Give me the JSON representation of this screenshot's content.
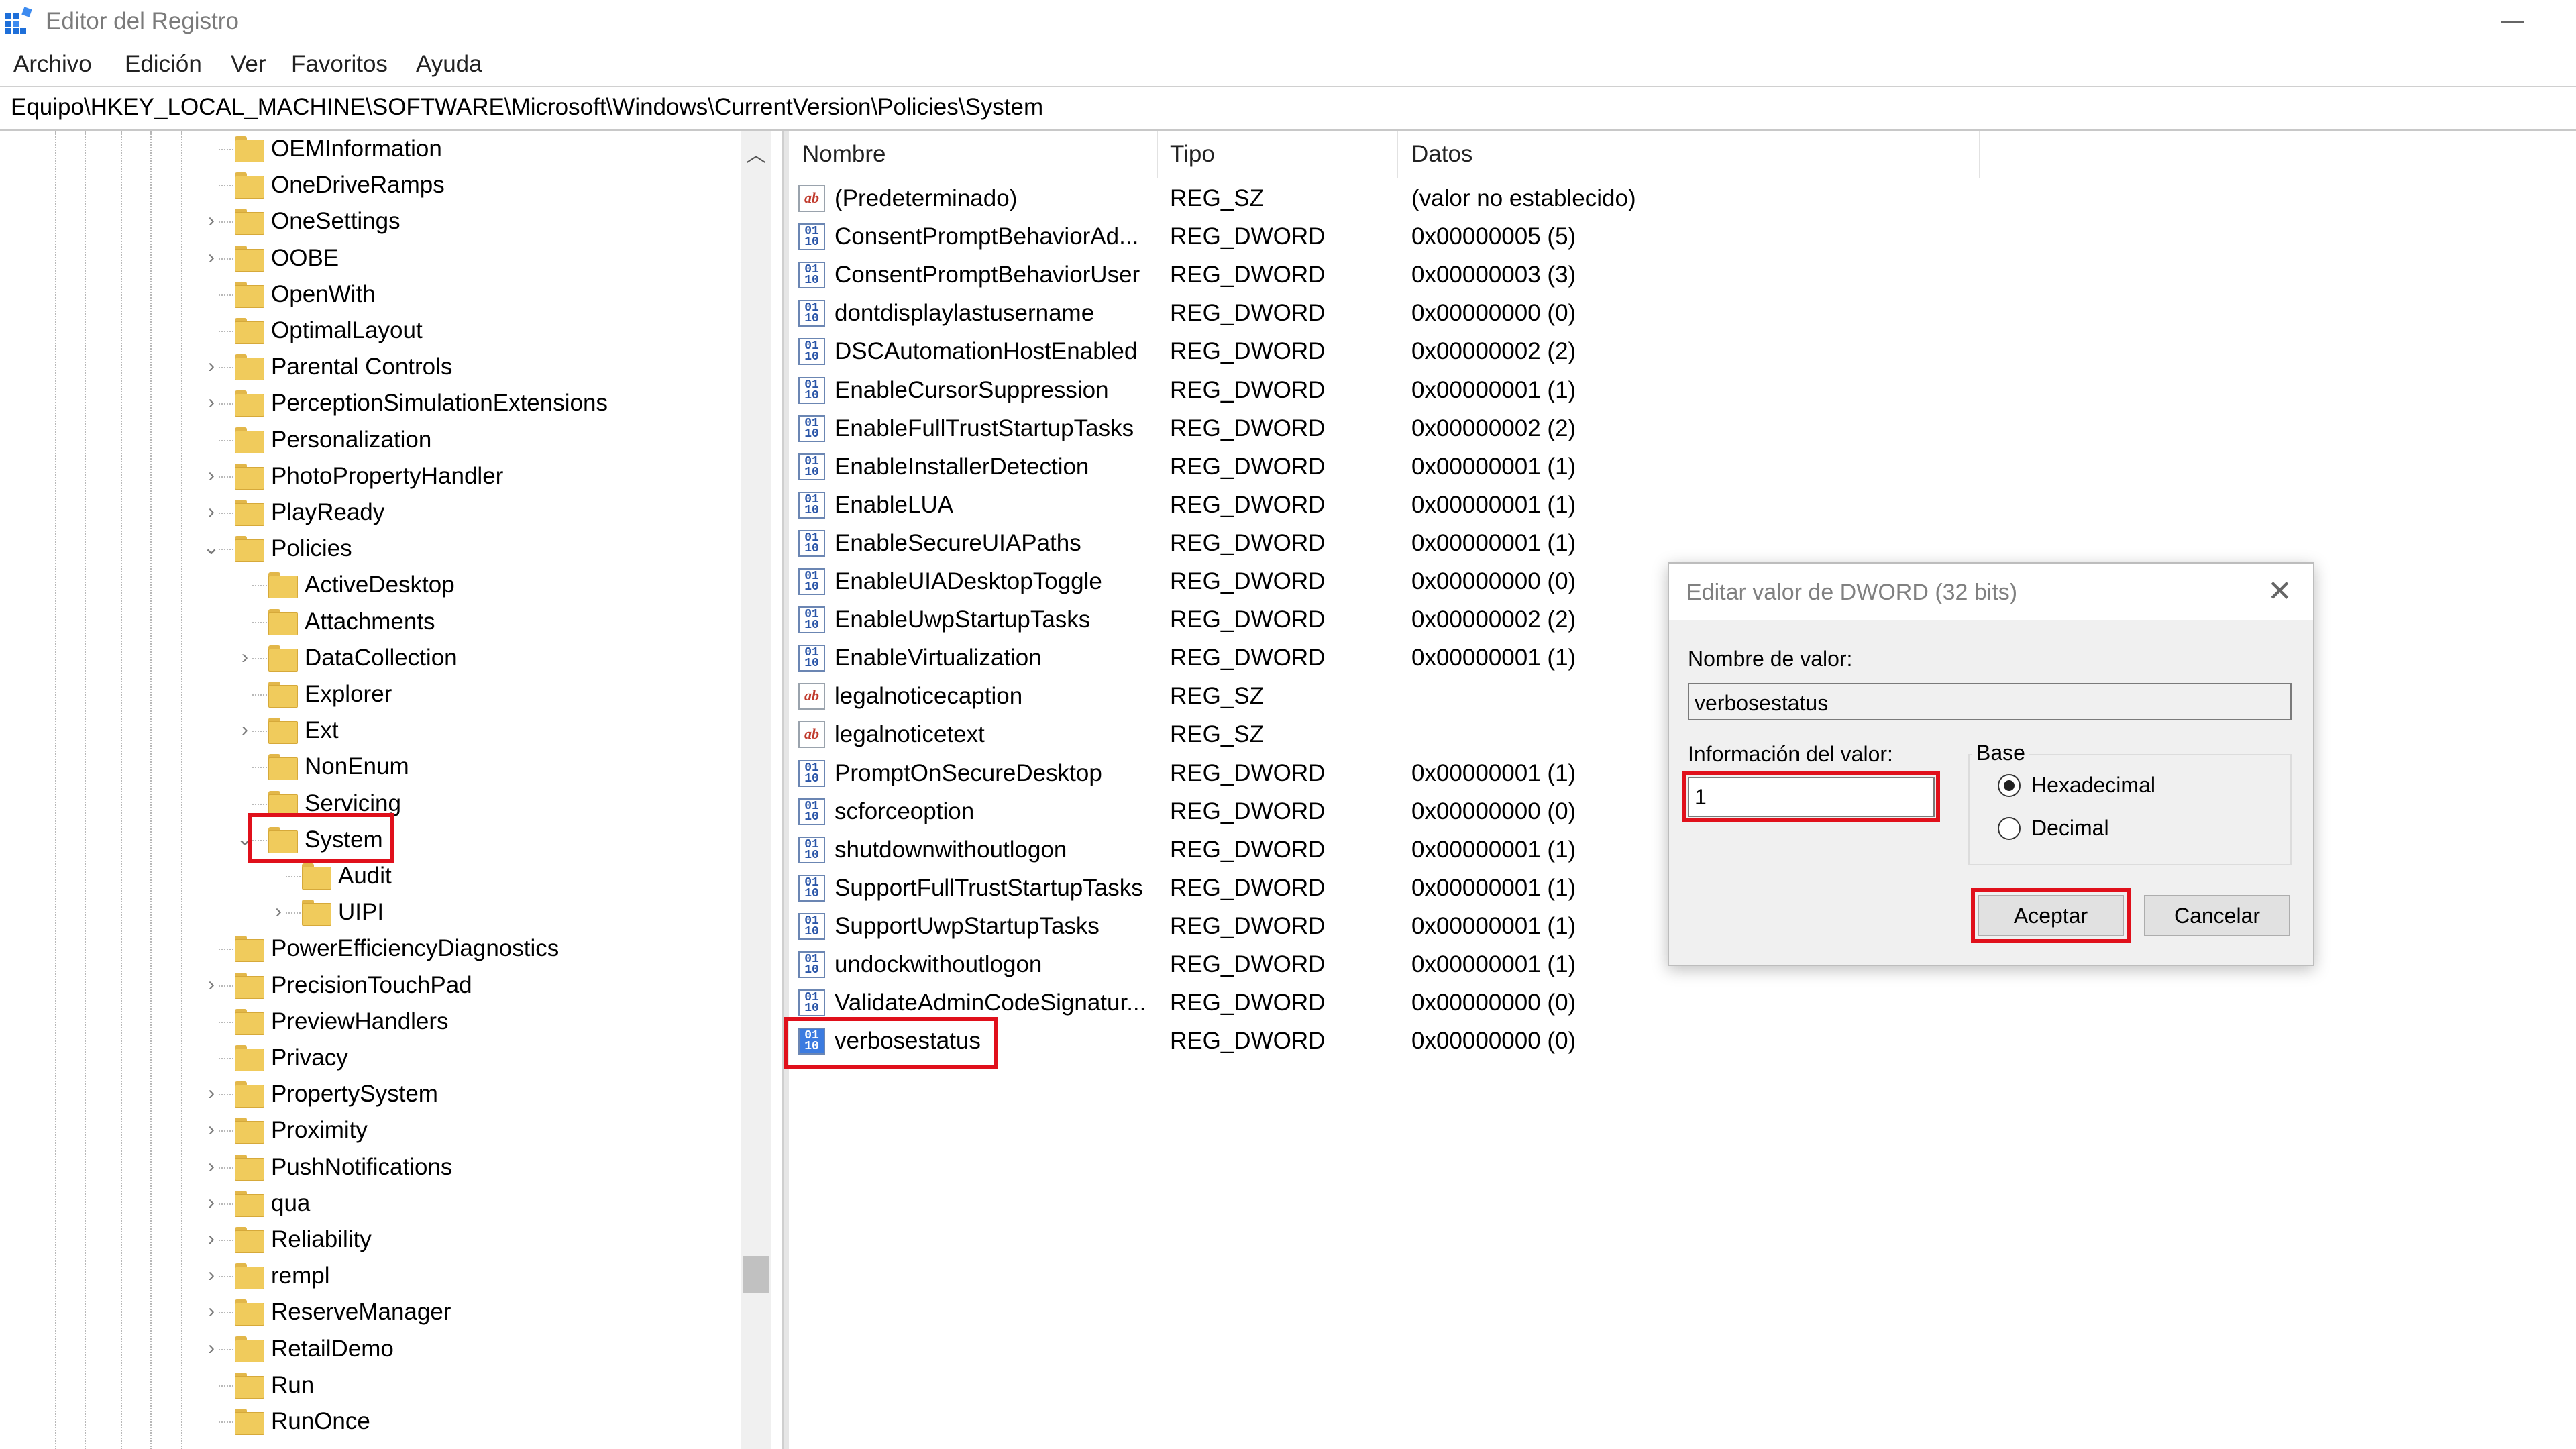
{
  "window": {
    "title": "Editor del Registro"
  },
  "menu": [
    "Archivo",
    "Edición",
    "Ver",
    "Favoritos",
    "Ayuda"
  ],
  "address": "Equipo\\HKEY_LOCAL_MACHINE\\SOFTWARE\\Microsoft\\Windows\\CurrentVersion\\Policies\\System",
  "tree": [
    {
      "label": "OEMInformation",
      "level": 0,
      "expander": "none"
    },
    {
      "label": "OneDriveRamps",
      "level": 0,
      "expander": "none"
    },
    {
      "label": "OneSettings",
      "level": 0,
      "expander": "collapsed"
    },
    {
      "label": "OOBE",
      "level": 0,
      "expander": "collapsed"
    },
    {
      "label": "OpenWith",
      "level": 0,
      "expander": "none"
    },
    {
      "label": "OptimalLayout",
      "level": 0,
      "expander": "none"
    },
    {
      "label": "Parental Controls",
      "level": 0,
      "expander": "collapsed"
    },
    {
      "label": "PerceptionSimulationExtensions",
      "level": 0,
      "expander": "collapsed"
    },
    {
      "label": "Personalization",
      "level": 0,
      "expander": "none"
    },
    {
      "label": "PhotoPropertyHandler",
      "level": 0,
      "expander": "collapsed"
    },
    {
      "label": "PlayReady",
      "level": 0,
      "expander": "collapsed"
    },
    {
      "label": "Policies",
      "level": 0,
      "expander": "expanded"
    },
    {
      "label": "ActiveDesktop",
      "level": 1,
      "expander": "none"
    },
    {
      "label": "Attachments",
      "level": 1,
      "expander": "none"
    },
    {
      "label": "DataCollection",
      "level": 1,
      "expander": "collapsed"
    },
    {
      "label": "Explorer",
      "level": 1,
      "expander": "none"
    },
    {
      "label": "Ext",
      "level": 1,
      "expander": "collapsed"
    },
    {
      "label": "NonEnum",
      "level": 1,
      "expander": "none"
    },
    {
      "label": "Servicing",
      "level": 1,
      "expander": "none"
    },
    {
      "label": "System",
      "level": 1,
      "expander": "expanded",
      "selected": true
    },
    {
      "label": "Audit",
      "level": 2,
      "expander": "none"
    },
    {
      "label": "UIPI",
      "level": 2,
      "expander": "collapsed"
    },
    {
      "label": "PowerEfficiencyDiagnostics",
      "level": 0,
      "expander": "none"
    },
    {
      "label": "PrecisionTouchPad",
      "level": 0,
      "expander": "collapsed"
    },
    {
      "label": "PreviewHandlers",
      "level": 0,
      "expander": "none"
    },
    {
      "label": "Privacy",
      "level": 0,
      "expander": "none"
    },
    {
      "label": "PropertySystem",
      "level": 0,
      "expander": "collapsed"
    },
    {
      "label": "Proximity",
      "level": 0,
      "expander": "collapsed"
    },
    {
      "label": "PushNotifications",
      "level": 0,
      "expander": "collapsed"
    },
    {
      "label": "qua",
      "level": 0,
      "expander": "collapsed"
    },
    {
      "label": "Reliability",
      "level": 0,
      "expander": "collapsed"
    },
    {
      "label": "rempl",
      "level": 0,
      "expander": "collapsed"
    },
    {
      "label": "ReserveManager",
      "level": 0,
      "expander": "collapsed"
    },
    {
      "label": "RetailDemo",
      "level": 0,
      "expander": "collapsed"
    },
    {
      "label": "Run",
      "level": 0,
      "expander": "none"
    },
    {
      "label": "RunOnce",
      "level": 0,
      "expander": "none"
    }
  ],
  "columns": {
    "name": "Nombre",
    "type": "Tipo",
    "data": "Datos"
  },
  "values": [
    {
      "name": "(Predeterminado)",
      "type": "REG_SZ",
      "data": "(valor no establecido)",
      "icon": "string-value-icon"
    },
    {
      "name": "ConsentPromptBehaviorAd...",
      "type": "REG_DWORD",
      "data": "0x00000005 (5)",
      "icon": "dword-value-icon"
    },
    {
      "name": "ConsentPromptBehaviorUser",
      "type": "REG_DWORD",
      "data": "0x00000003 (3)",
      "icon": "dword-value-icon"
    },
    {
      "name": "dontdisplaylastusername",
      "type": "REG_DWORD",
      "data": "0x00000000 (0)",
      "icon": "dword-value-icon"
    },
    {
      "name": "DSCAutomationHostEnabled",
      "type": "REG_DWORD",
      "data": "0x00000002 (2)",
      "icon": "dword-value-icon"
    },
    {
      "name": "EnableCursorSuppression",
      "type": "REG_DWORD",
      "data": "0x00000001 (1)",
      "icon": "dword-value-icon"
    },
    {
      "name": "EnableFullTrustStartupTasks",
      "type": "REG_DWORD",
      "data": "0x00000002 (2)",
      "icon": "dword-value-icon"
    },
    {
      "name": "EnableInstallerDetection",
      "type": "REG_DWORD",
      "data": "0x00000001 (1)",
      "icon": "dword-value-icon"
    },
    {
      "name": "EnableLUA",
      "type": "REG_DWORD",
      "data": "0x00000001 (1)",
      "icon": "dword-value-icon"
    },
    {
      "name": "EnableSecureUIAPaths",
      "type": "REG_DWORD",
      "data": "0x00000001 (1)",
      "icon": "dword-value-icon"
    },
    {
      "name": "EnableUIADesktopToggle",
      "type": "REG_DWORD",
      "data": "0x00000000 (0)",
      "icon": "dword-value-icon"
    },
    {
      "name": "EnableUwpStartupTasks",
      "type": "REG_DWORD",
      "data": "0x00000002 (2)",
      "icon": "dword-value-icon"
    },
    {
      "name": "EnableVirtualization",
      "type": "REG_DWORD",
      "data": "0x00000001 (1)",
      "icon": "dword-value-icon"
    },
    {
      "name": "legalnoticecaption",
      "type": "REG_SZ",
      "data": "",
      "icon": "string-value-icon"
    },
    {
      "name": "legalnoticetext",
      "type": "REG_SZ",
      "data": "",
      "icon": "string-value-icon"
    },
    {
      "name": "PromptOnSecureDesktop",
      "type": "REG_DWORD",
      "data": "0x00000001 (1)",
      "icon": "dword-value-icon"
    },
    {
      "name": "scforceoption",
      "type": "REG_DWORD",
      "data": "0x00000000 (0)",
      "icon": "dword-value-icon"
    },
    {
      "name": "shutdownwithoutlogon",
      "type": "REG_DWORD",
      "data": "0x00000001 (1)",
      "icon": "dword-value-icon"
    },
    {
      "name": "SupportFullTrustStartupTasks",
      "type": "REG_DWORD",
      "data": "0x00000001 (1)",
      "icon": "dword-value-icon"
    },
    {
      "name": "SupportUwpStartupTasks",
      "type": "REG_DWORD",
      "data": "0x00000001 (1)",
      "icon": "dword-value-icon"
    },
    {
      "name": "undockwithoutlogon",
      "type": "REG_DWORD",
      "data": "0x00000001 (1)",
      "icon": "dword-value-icon"
    },
    {
      "name": "ValidateAdminCodeSignatur...",
      "type": "REG_DWORD",
      "data": "0x00000000 (0)",
      "icon": "dword-value-icon"
    },
    {
      "name": "verbosestatus",
      "type": "REG_DWORD",
      "data": "0x00000000 (0)",
      "icon": "dword-value-icon",
      "highlighted": true
    }
  ],
  "dialog": {
    "title": "Editar valor de DWORD (32 bits)",
    "close_glyph": "✕",
    "name_label": "Nombre de valor:",
    "name_value": "verbosestatus",
    "data_label": "Información del valor:",
    "data_value": "1",
    "base_label": "Base",
    "base_options": [
      "Hexadecimal",
      "Decimal"
    ],
    "base_selected": "Hexadecimal",
    "ok_label": "Aceptar",
    "cancel_label": "Cancelar"
  },
  "colors": {
    "highlight": "#e0101b",
    "folder": "#f0cb5c"
  }
}
